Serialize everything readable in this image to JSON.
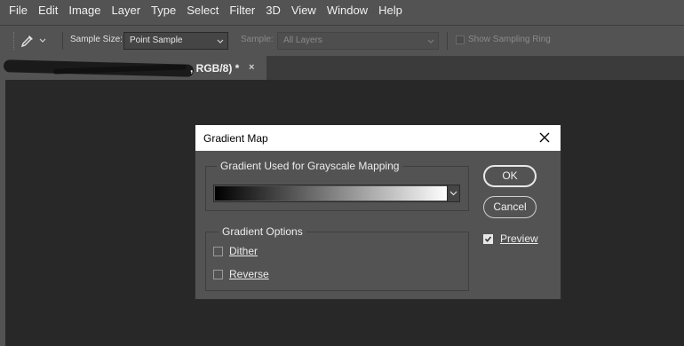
{
  "menubar": {
    "items": [
      "File",
      "Edit",
      "Image",
      "Layer",
      "Type",
      "Select",
      "Filter",
      "3D",
      "View",
      "Window",
      "Help"
    ]
  },
  "optionsbar": {
    "tool_icon": "eyedropper-icon",
    "sample_size_label": "Sample Size:",
    "sample_size_value": "Point Sample",
    "sample_label": "Sample:",
    "sample_value": "All Layers",
    "show_sampling_ring_label": "Show Sampling Ring",
    "show_sampling_ring_checked": false
  },
  "tab": {
    "title_visible": ", RGB/8) *",
    "close_label": "×"
  },
  "dialog": {
    "title": "Gradient Map",
    "gradient_group_label": "Gradient Used for Grayscale Mapping",
    "gradient_from": "#000000",
    "gradient_to": "#ffffff",
    "options_group_label": "Gradient Options",
    "dither_label": "Dither",
    "dither_checked": false,
    "reverse_label": "Reverse",
    "reverse_checked": false,
    "ok_label": "OK",
    "cancel_label": "Cancel",
    "preview_label": "Preview",
    "preview_checked": true
  }
}
